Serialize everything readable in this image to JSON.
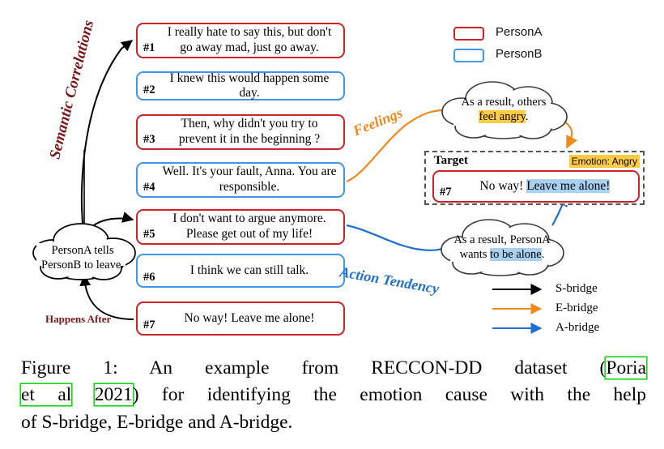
{
  "figure": {
    "dialogue": {
      "utterances": [
        {
          "id": "#1",
          "speaker": "PersonA",
          "text": "I really hate to say this, but don't go away mad, just go away."
        },
        {
          "id": "#2",
          "speaker": "PersonB",
          "text": "I knew this would happen some day."
        },
        {
          "id": "#3",
          "speaker": "PersonA",
          "text": "Then, why didn't you try to prevent it in the beginning ?"
        },
        {
          "id": "#4",
          "speaker": "PersonB",
          "text": "Well. It's your fault, Anna. You are responsible."
        },
        {
          "id": "#5",
          "speaker": "PersonA",
          "text": "I don't want to argue anymore. Please get out of my life!"
        },
        {
          "id": "#6",
          "speaker": "PersonB",
          "text": "I think we can still talk."
        },
        {
          "id": "#7",
          "speaker": "PersonA",
          "text": "No way! Leave me alone!"
        }
      ]
    },
    "legend": {
      "personA_label": "PersonA",
      "personB_label": "PersonB",
      "personA_color": "#cc2229",
      "personB_color": "#3f96e8"
    },
    "clouds": {
      "semantic": {
        "line1": "PersonA tells",
        "line2": "PersonB to leave."
      },
      "feelings": {
        "line1": "As a result, others",
        "line2_highlight": "feel angry",
        "line2_tail": ".",
        "highlight_color": "#ffcc44"
      },
      "action": {
        "line1": "As a result, PersonA",
        "line2_prefix": "wants ",
        "line2_highlight": "to be alone",
        "line2_tail": ".",
        "highlight_color": "#a8d0f0"
      }
    },
    "bridge_labels": {
      "semantic": "Semantic Correlations",
      "feelings": "Feelings",
      "action": "Action Tendency",
      "happens_after": "Happens After"
    },
    "target": {
      "title": "Target",
      "emotion_badge": "Emotion: Angry",
      "utterance_id": "#7",
      "text_prefix": "No way! ",
      "text_highlight": "Leave me alone!",
      "highlight_color": "#a8d0f0",
      "badge_color": "#ffcc44"
    },
    "arrow_legend": {
      "items": [
        {
          "label": "S-bridge",
          "color": "#000000"
        },
        {
          "label": "E-bridge",
          "color": "#f08a1e"
        },
        {
          "label": "A-bridge",
          "color": "#1f6fd0"
        }
      ]
    },
    "caption": {
      "line1_a": "Figure 1: An example from RECCON-DD dataset (",
      "cite_author": "Poria",
      "line2_a": "",
      "cite_etal": "et al",
      "cite_year": "2021",
      "line2_b": ") for identifying the emotion cause with the help",
      "line3": "of S-bridge, E-bridge and A-bridge.",
      "cite_box_color": "#17d617"
    }
  }
}
